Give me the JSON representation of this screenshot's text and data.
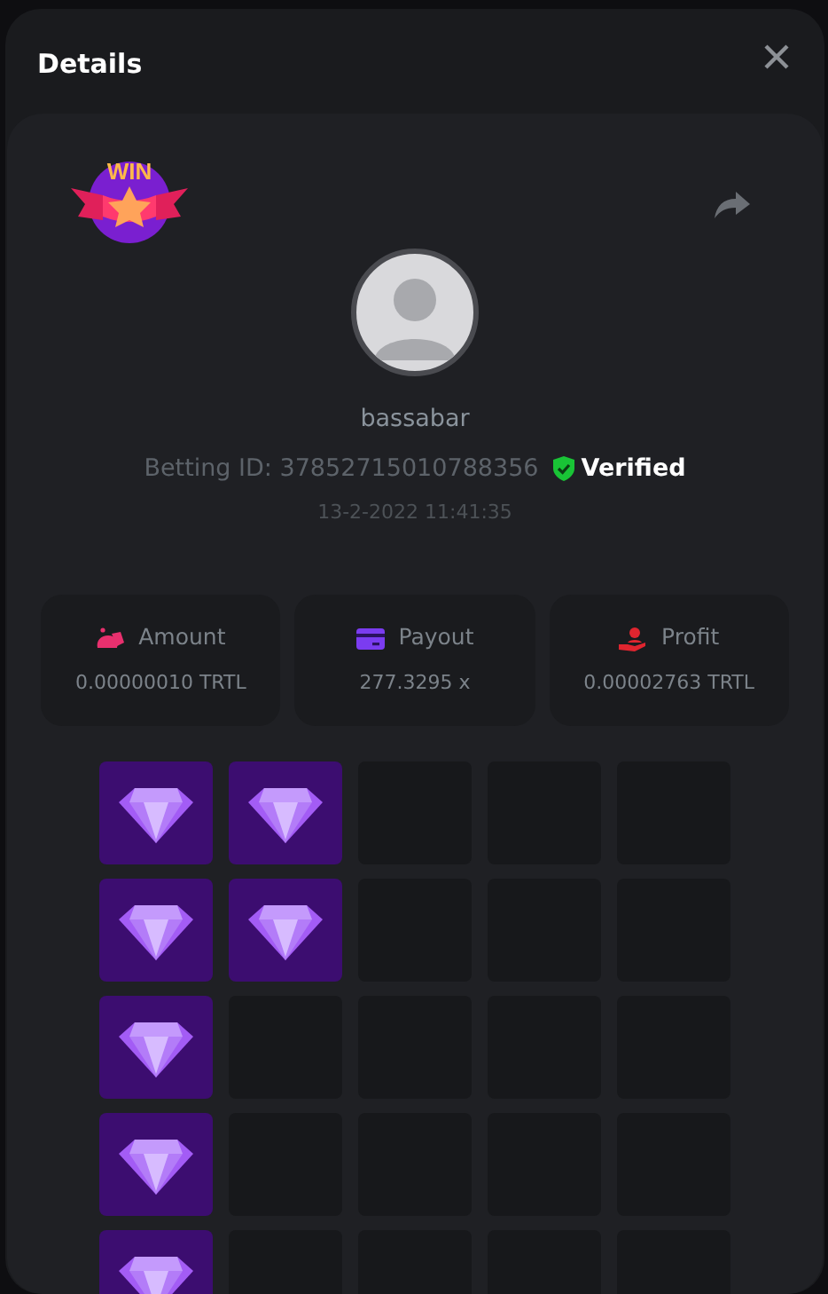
{
  "window": {
    "title": "Details"
  },
  "badge": {
    "text": "WIN"
  },
  "player": {
    "username": "bassabar",
    "betting_id": "Betting ID: 37852715010788356",
    "verified": true,
    "verified_label": "Verified",
    "date": "13-2-2022 11:41:35"
  },
  "stats": [
    {
      "kind": "amount",
      "label": "Amount",
      "value": "0.00000010 TRTL"
    },
    {
      "kind": "payout",
      "label": "Payout",
      "value": "277.3295 x"
    },
    {
      "kind": "profit",
      "label": "Profit",
      "value": "0.00002763 TRTL"
    }
  ],
  "grid": [
    [
      {
        "revealed": true
      },
      {
        "revealed": true
      },
      {
        "revealed": false
      },
      {
        "revealed": false
      },
      {
        "revealed": false
      }
    ],
    [
      {
        "revealed": true
      },
      {
        "revealed": true
      },
      {
        "revealed": false
      },
      {
        "revealed": false
      },
      {
        "revealed": false
      }
    ],
    [
      {
        "revealed": true
      },
      {
        "revealed": false
      },
      {
        "revealed": false
      },
      {
        "revealed": false
      },
      {
        "revealed": false
      }
    ],
    [
      {
        "revealed": true
      },
      {
        "revealed": false
      },
      {
        "revealed": false
      },
      {
        "revealed": false
      },
      {
        "revealed": false
      }
    ],
    [
      {
        "revealed": true
      },
      {
        "revealed": false
      },
      {
        "revealed": false
      },
      {
        "revealed": false
      },
      {
        "revealed": false
      }
    ]
  ]
}
